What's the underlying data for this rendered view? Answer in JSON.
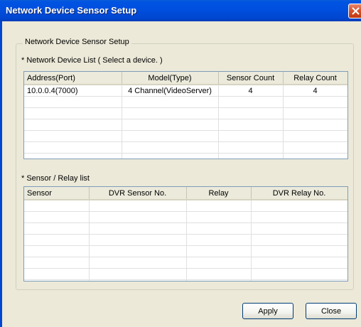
{
  "window": {
    "title": "Network Device Sensor Setup"
  },
  "group": {
    "legend": "Network Device Sensor Setup"
  },
  "device_list": {
    "label": "* Network Device List ( Select a device. )",
    "columns": [
      "Address(Port)",
      "Model(Type)",
      "Sensor Count",
      "Relay Count"
    ],
    "rows": [
      [
        "10.0.0.4(7000)",
        "4 Channel(VideoServer)",
        "4",
        "4"
      ]
    ]
  },
  "sensor_list": {
    "label": "* Sensor / Relay list",
    "columns": [
      "Sensor",
      "DVR Sensor No.",
      "Relay",
      "DVR Relay No."
    ],
    "rows": []
  },
  "buttons": {
    "apply": "Apply",
    "close": "Close"
  },
  "colors": {
    "titlebar": "#0050e0",
    "close_button": "#d5502b",
    "face": "#ece9d8"
  }
}
